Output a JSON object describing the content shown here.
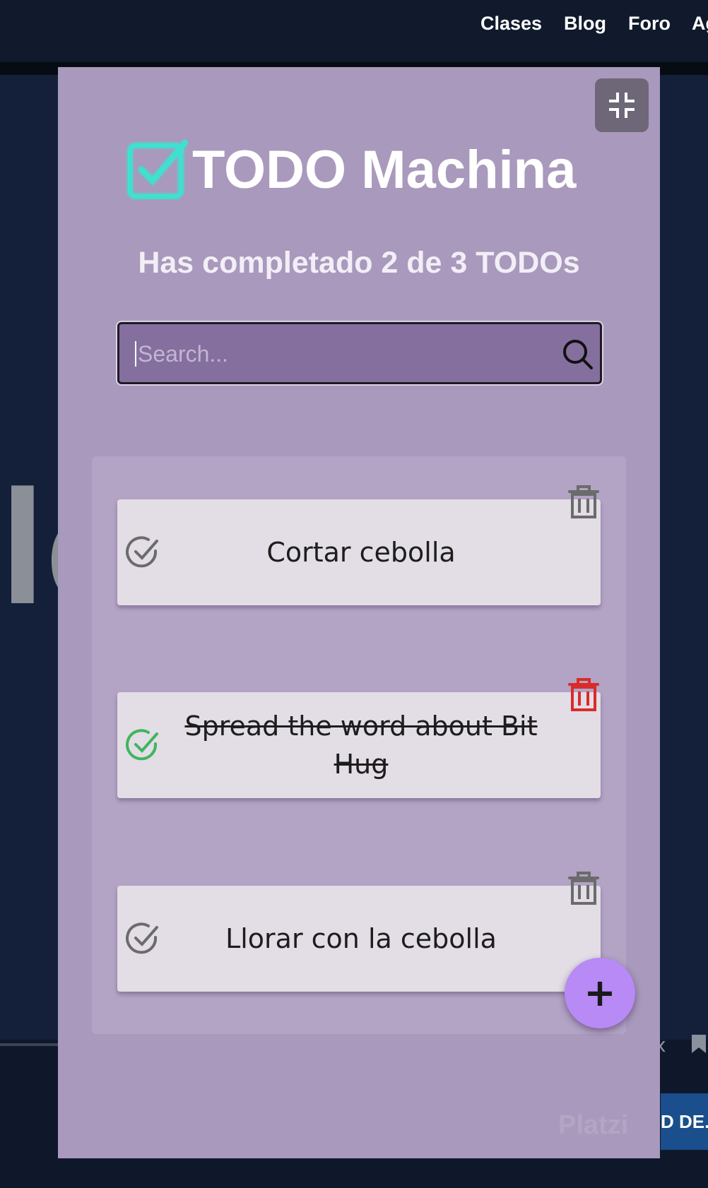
{
  "nav": {
    "links": [
      "Clases",
      "Blog",
      "Foro",
      "Ag"
    ]
  },
  "background": {
    "letter": "lc",
    "cta_label": "D DE...",
    "close_glyph": "x",
    "watermark": "Platzi"
  },
  "app": {
    "title": "TODO Machina",
    "counter": "Has completado 2 de 3 TODOs",
    "search": {
      "placeholder": "Search...",
      "value": ""
    },
    "fab_label": "+",
    "colors": {
      "panel": "#a999bc",
      "logo": "#3fe0d0",
      "check_done": "#3fb65c",
      "check_pending": "#6b6b6b",
      "delete_active": "#d92b2b",
      "fab": "#b78af5"
    },
    "icons": {
      "collapse": "collapse-arrows-icon",
      "logo": "checkbox-icon",
      "search": "search-icon",
      "check": "check-circle-icon",
      "delete": "trash-icon"
    },
    "todos": [
      {
        "text": "Cortar cebolla",
        "completed": false
      },
      {
        "text": "Spread the word about Bit Hug",
        "completed": true
      },
      {
        "text": "Llorar con la cebolla",
        "completed": false
      }
    ]
  }
}
